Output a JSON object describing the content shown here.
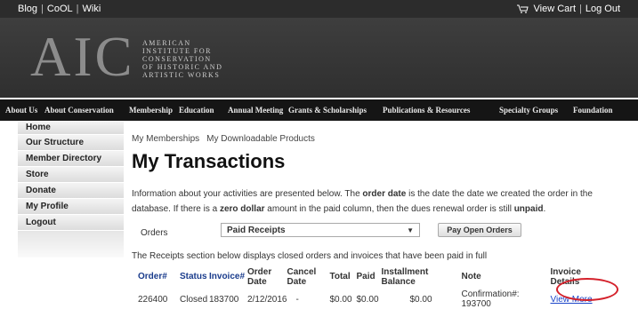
{
  "topbar": {
    "links": [
      "Blog",
      "CoOL",
      "Wiki"
    ],
    "cart_label": "View Cart",
    "logout_label": "Log Out"
  },
  "logo": {
    "letters": "AIC",
    "lines": [
      "AMERICAN",
      "INSTITUTE FOR",
      "CONSERVATION",
      "OF HISTORIC AND",
      "ARTISTIC WORKS"
    ]
  },
  "nav": [
    "About Us",
    "About Conservation",
    "Membership",
    "Education",
    "Annual Meeting",
    "Grants & Scholarships",
    "Publications & Resources",
    "Specialty Groups",
    "Foundation"
  ],
  "sidebar": [
    "Home",
    "Our Structure",
    "Member Directory",
    "Store",
    "Donate",
    "My Profile",
    "Logout"
  ],
  "tabs": [
    "My Memberships",
    "My Downloadable Products"
  ],
  "page_title": "My Transactions",
  "intro": {
    "p1": "Information about your activities are presented below. The ",
    "b1": "order date",
    "p2": " is the date the date we created the order in the database. If there is a ",
    "b2": "zero dollar",
    "p3": " amount in the paid column, then the dues renewal order is still ",
    "b3": "unpaid",
    "p4": "."
  },
  "orders_filter": {
    "label": "Orders",
    "selected": "Paid Receipts",
    "button": "Pay Open Orders"
  },
  "receipts_note": "The Receipts section below displays closed orders and invoices that have been paid in full",
  "table": {
    "headers": [
      "Order#",
      "Status",
      "Invoice#",
      "Order Date",
      "Cancel Date",
      "Total",
      "Paid",
      "Installment Balance",
      "Note",
      "Invoice Details"
    ],
    "row": [
      "226400",
      "Closed",
      "183700",
      "2/12/2016",
      "-",
      "$0.00",
      "$0.00",
      "$0.00",
      "Confirmation#: 193700",
      "View More"
    ]
  },
  "colors": {
    "highlight_ellipse": "#d4202a",
    "header_link": "#1a3c8c",
    "nav_bg": "#151515"
  }
}
